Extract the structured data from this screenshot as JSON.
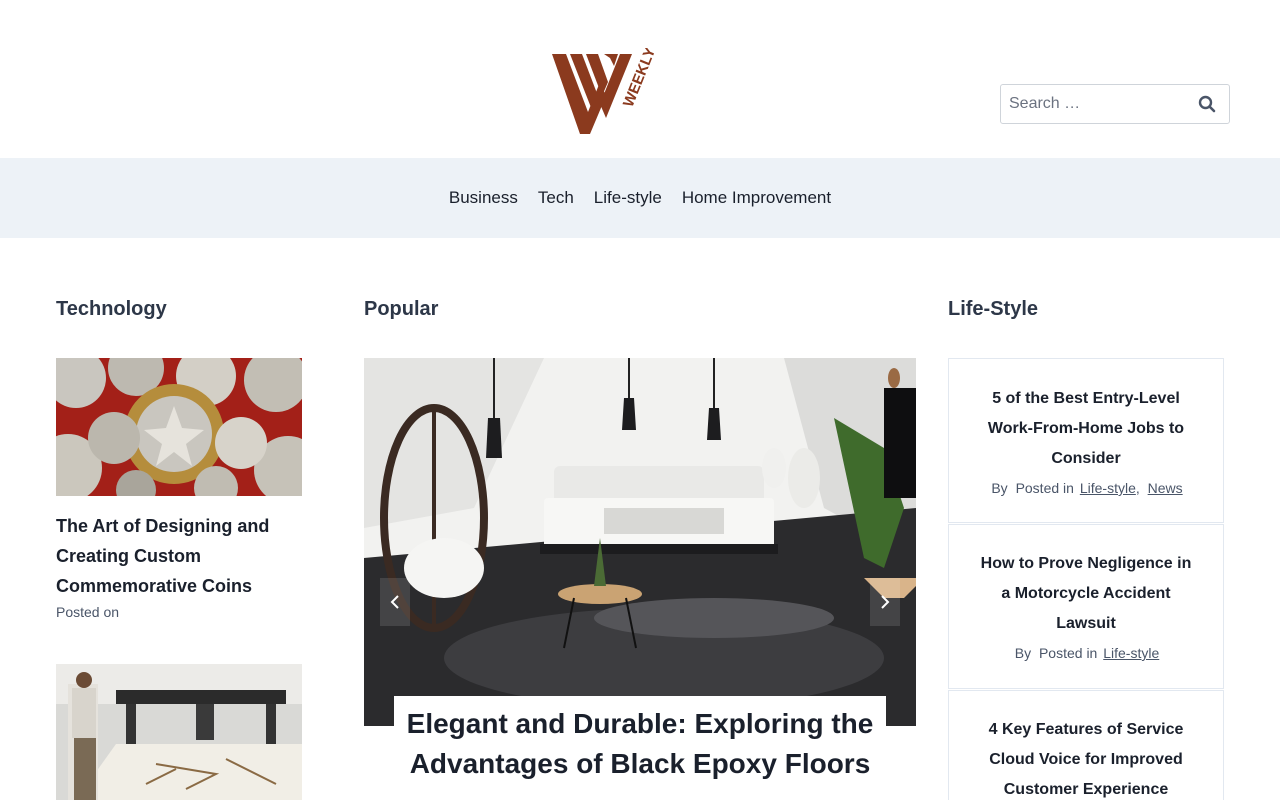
{
  "header": {
    "logo_text": "WEEKLY",
    "brand_color": "#8b3a1e"
  },
  "search": {
    "placeholder": "Search …",
    "icon": "search-icon"
  },
  "nav": {
    "items": [
      {
        "label": "Business"
      },
      {
        "label": "Tech"
      },
      {
        "label": "Life-style"
      },
      {
        "label": "Home Improvement"
      }
    ]
  },
  "technology": {
    "heading": "Technology",
    "posts": [
      {
        "title": "The Art of Designing and Creating Custom Commemorative Coins",
        "meta": "Posted on"
      }
    ]
  },
  "popular": {
    "heading": "Popular",
    "slide_title": "Elegant and Durable: Exploring the Advantages of Black Epoxy Floors",
    "prev_icon": "chevron-left-icon",
    "next_icon": "chevron-right-icon"
  },
  "lifestyle": {
    "heading": "Life-Style",
    "posts": [
      {
        "title": "5 of the Best Entry-Level Work-From-Home Jobs to Consider",
        "by": "By",
        "posted_in": "Posted in",
        "cat1": "Life-style",
        "sep": ",",
        "cat2": "News"
      },
      {
        "title": "How to Prove Negligence in a Motorcycle Accident Lawsuit",
        "by": "By",
        "posted_in": "Posted in",
        "cat1": "Life-style"
      },
      {
        "title": "4 Key Features of Service Cloud Voice for Improved Customer Experience"
      }
    ]
  }
}
